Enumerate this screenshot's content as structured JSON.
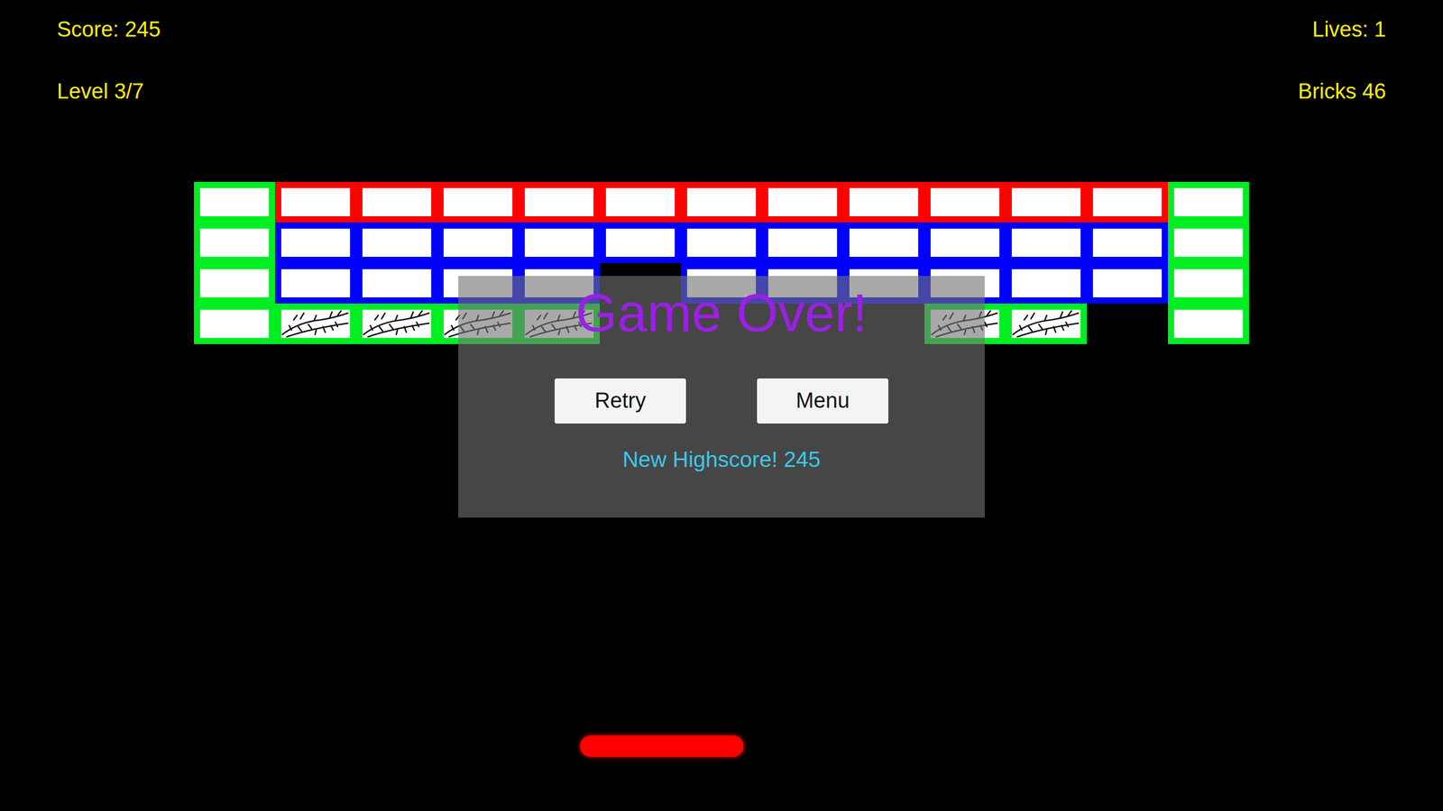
{
  "hud": {
    "score": "Score: 245",
    "lives": "Lives: 1",
    "level": "Level 3/7",
    "bricks": "Bricks 46"
  },
  "bricks": [
    [
      {
        "kind": "normal",
        "color": "#00ee22"
      },
      {
        "kind": "normal",
        "color": "#ff0000"
      },
      {
        "kind": "normal",
        "color": "#ff0000"
      },
      {
        "kind": "normal",
        "color": "#ff0000"
      },
      {
        "kind": "normal",
        "color": "#ff0000"
      },
      {
        "kind": "normal",
        "color": "#ff0000"
      },
      {
        "kind": "normal",
        "color": "#ff0000"
      },
      {
        "kind": "normal",
        "color": "#ff0000"
      },
      {
        "kind": "normal",
        "color": "#ff0000"
      },
      {
        "kind": "normal",
        "color": "#ff0000"
      },
      {
        "kind": "normal",
        "color": "#ff0000"
      },
      {
        "kind": "normal",
        "color": "#ff0000"
      },
      {
        "kind": "normal",
        "color": "#00ee22"
      }
    ],
    [
      {
        "kind": "normal",
        "color": "#00ee22"
      },
      {
        "kind": "normal",
        "color": "#0000ff"
      },
      {
        "kind": "normal",
        "color": "#0000ff"
      },
      {
        "kind": "normal",
        "color": "#0000ff"
      },
      {
        "kind": "normal",
        "color": "#0000ff"
      },
      {
        "kind": "normal",
        "color": "#0000ff"
      },
      {
        "kind": "normal",
        "color": "#0000ff"
      },
      {
        "kind": "normal",
        "color": "#0000ff"
      },
      {
        "kind": "normal",
        "color": "#0000ff"
      },
      {
        "kind": "normal",
        "color": "#0000ff"
      },
      {
        "kind": "normal",
        "color": "#0000ff"
      },
      {
        "kind": "normal",
        "color": "#0000ff"
      },
      {
        "kind": "normal",
        "color": "#00ee22"
      }
    ],
    [
      {
        "kind": "normal",
        "color": "#00ee22"
      },
      {
        "kind": "normal",
        "color": "#0000ff"
      },
      {
        "kind": "normal",
        "color": "#0000ff"
      },
      {
        "kind": "normal",
        "color": "#0000ff"
      },
      {
        "kind": "normal",
        "color": "#0000ff"
      },
      {
        "kind": "empty"
      },
      {
        "kind": "normal",
        "color": "#0000ff"
      },
      {
        "kind": "normal",
        "color": "#0000ff"
      },
      {
        "kind": "normal",
        "color": "#0000ff"
      },
      {
        "kind": "normal",
        "color": "#0000ff"
      },
      {
        "kind": "normal",
        "color": "#0000ff"
      },
      {
        "kind": "normal",
        "color": "#0000ff"
      },
      {
        "kind": "normal",
        "color": "#00ee22"
      }
    ],
    [
      {
        "kind": "normal",
        "color": "#00ee22"
      },
      {
        "kind": "cracked",
        "color": "#00ee22"
      },
      {
        "kind": "cracked",
        "color": "#00ee22"
      },
      {
        "kind": "cracked",
        "color": "#00ee22"
      },
      {
        "kind": "cracked",
        "color": "#00ee22"
      },
      {
        "kind": "empty"
      },
      {
        "kind": "empty"
      },
      {
        "kind": "empty"
      },
      {
        "kind": "empty"
      },
      {
        "kind": "cracked",
        "color": "#00ee22"
      },
      {
        "kind": "cracked",
        "color": "#00ee22"
      },
      {
        "kind": "empty"
      },
      {
        "kind": "normal",
        "color": "#00ee22"
      }
    ]
  ],
  "dialog": {
    "title": "Game Over!",
    "buttons": [
      "Retry",
      "Menu"
    ],
    "message": "New Highscore! 245"
  }
}
